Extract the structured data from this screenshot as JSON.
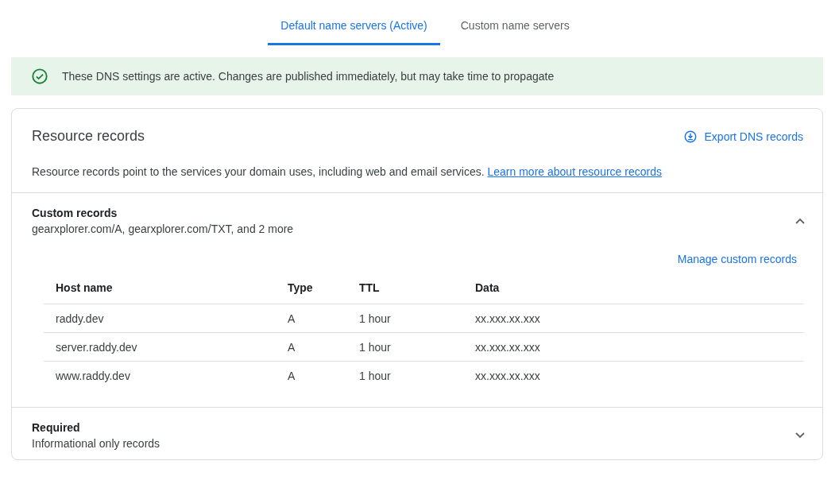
{
  "tabs": [
    {
      "label": "Default name servers (Active)",
      "selected": true
    },
    {
      "label": "Custom name servers",
      "selected": false
    }
  ],
  "banner": {
    "text": "These DNS settings are active. Changes are published immediately, but may take time to propagate"
  },
  "card": {
    "title": "Resource records",
    "export_link": "Export DNS records",
    "description": "Resource records point to the services your domain uses, including web and email services.",
    "description_link": "Learn more about resource records",
    "sections": [
      {
        "title": "Custom records",
        "summary": "gearxplorer.com/A, gearxplorer.com/TXT, and 2 more",
        "expanded": true,
        "action_link": "Manage custom records",
        "table": {
          "columns": [
            "Host name",
            "Type",
            "TTL",
            "Data"
          ],
          "rows": [
            [
              "raddy.dev",
              "A",
              "1 hour",
              "xx.xxx.xx.xxx"
            ],
            [
              "server.raddy.dev",
              "A",
              "1 hour",
              "xx.xxx.xx.xxx"
            ],
            [
              "www.raddy.dev",
              "A",
              "1 hour",
              "xx.xxx.xx.xxx"
            ]
          ]
        }
      },
      {
        "title": "Required",
        "summary": "Informational only records",
        "expanded": false
      }
    ]
  }
}
